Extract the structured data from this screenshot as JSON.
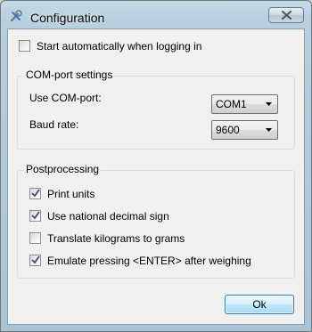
{
  "window": {
    "title": "Configuration",
    "app_icon": "wrench-screwdriver-icon",
    "close_icon": "close-x-icon"
  },
  "autostart": {
    "label": "Start automatically when logging in",
    "checked": false
  },
  "com_settings": {
    "group_title": "COM-port settings",
    "port_label": "Use COM-port:",
    "port_value": "COM1",
    "baud_label": "Baud rate:",
    "baud_value": "9600"
  },
  "postprocessing": {
    "group_title": "Postprocessing",
    "options": [
      {
        "label": "Print units",
        "checked": true
      },
      {
        "label": "Use national decimal sign",
        "checked": true
      },
      {
        "label": "Translate kilograms to grams",
        "checked": false
      },
      {
        "label": "Emulate pressing <ENTER> after weighing",
        "checked": true
      }
    ]
  },
  "buttons": {
    "ok_label": "Ok"
  }
}
